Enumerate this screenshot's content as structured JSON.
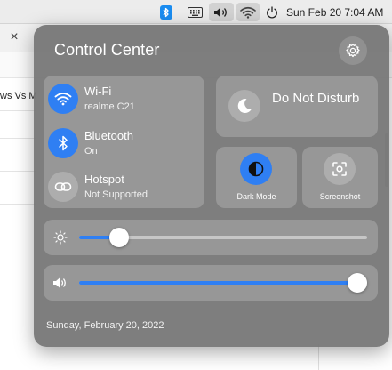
{
  "menubar": {
    "icons": [
      "bluetooth-icon",
      "keyboard-icon",
      "volume-icon",
      "wifi-icon",
      "power-icon"
    ],
    "clock": "Sun Feb 20  7:04 AM",
    "bluetooth_color": "#1a8cf0"
  },
  "background_app": {
    "tab_close": "×",
    "partial_text": "ws Vs M"
  },
  "control_center": {
    "title": "Control Center",
    "settings_icon": "gear-icon",
    "network": {
      "wifi": {
        "label": "Wi-Fi",
        "status": "realme C21",
        "active": true,
        "icon": "wifi-icon"
      },
      "bluetooth": {
        "label": "Bluetooth",
        "status": "On",
        "active": true,
        "icon": "bluetooth-icon"
      },
      "hotspot": {
        "label": "Hotspot",
        "status": "Not Supported",
        "active": false,
        "icon": "link-icon"
      }
    },
    "dnd": {
      "label": "Do Not Disturb",
      "active": false,
      "icon": "moon-icon"
    },
    "dark_mode": {
      "label": "Dark Mode",
      "active": true,
      "icon": "contrast-icon"
    },
    "screenshot": {
      "label": "Screenshot",
      "icon": "screenshot-icon"
    },
    "brightness": {
      "icon": "sun-icon",
      "level": 0.14
    },
    "volume": {
      "icon": "speaker-icon",
      "level": 0.965
    },
    "date": "Sunday, February 20, 2022",
    "accent_color": "#2f7ff3"
  }
}
